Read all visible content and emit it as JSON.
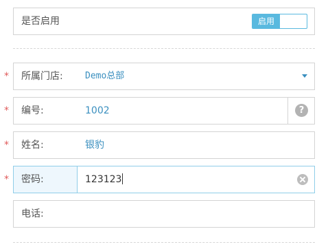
{
  "enabled_row": {
    "label": "是否启用",
    "toggle_label": "启用"
  },
  "fields": {
    "store": {
      "required_mark": "*",
      "label": "所属门店:",
      "value": "Demo总部"
    },
    "code": {
      "required_mark": "*",
      "label": "编号:",
      "value": "1002",
      "help_glyph": "?"
    },
    "name": {
      "required_mark": "*",
      "label": "姓名:",
      "value": "银豹"
    },
    "password": {
      "required_mark": "*",
      "label": "密码:",
      "value": "123123"
    },
    "phone": {
      "label": "电话:",
      "value": ""
    }
  },
  "icons": {
    "dropdown": "chevron-down-icon",
    "help": "question-icon",
    "clear": "clear-icon"
  },
  "colors": {
    "accent": "#59b9df",
    "value_text": "#3a8fbf",
    "required": "#e05a5a",
    "focus_border": "#8fcde8",
    "focus_label_bg": "#eef7fd"
  }
}
